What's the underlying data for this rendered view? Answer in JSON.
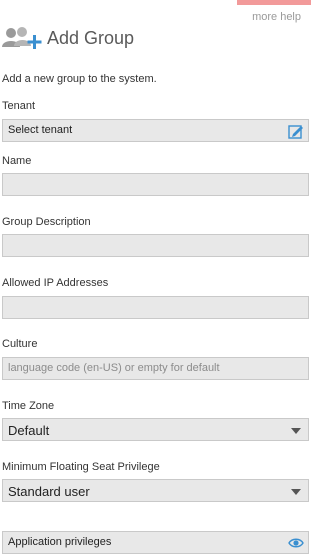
{
  "header": {
    "more_help": "more help",
    "title": "Add Group",
    "icon": "add-group-icon"
  },
  "form": {
    "intro": "Add a new group to the system.",
    "tenant": {
      "label": "Tenant",
      "value": "Select tenant"
    },
    "name": {
      "label": "Name",
      "value": ""
    },
    "description": {
      "label": "Group Description",
      "value": ""
    },
    "ip": {
      "label": "Allowed IP Addresses",
      "value": ""
    },
    "culture": {
      "label": "Culture",
      "placeholder": "language code (en-US) or empty for default"
    },
    "timezone": {
      "label": "Time Zone",
      "value": "Default"
    },
    "seat": {
      "label": "Minimum Floating Seat Privilege",
      "value": "Standard user"
    },
    "privileges": {
      "value": "Application privileges"
    }
  },
  "colors": {
    "accent": "#f29a9a",
    "field_bg": "#e8e8e8",
    "icon_blue": "#3a8fd0"
  }
}
